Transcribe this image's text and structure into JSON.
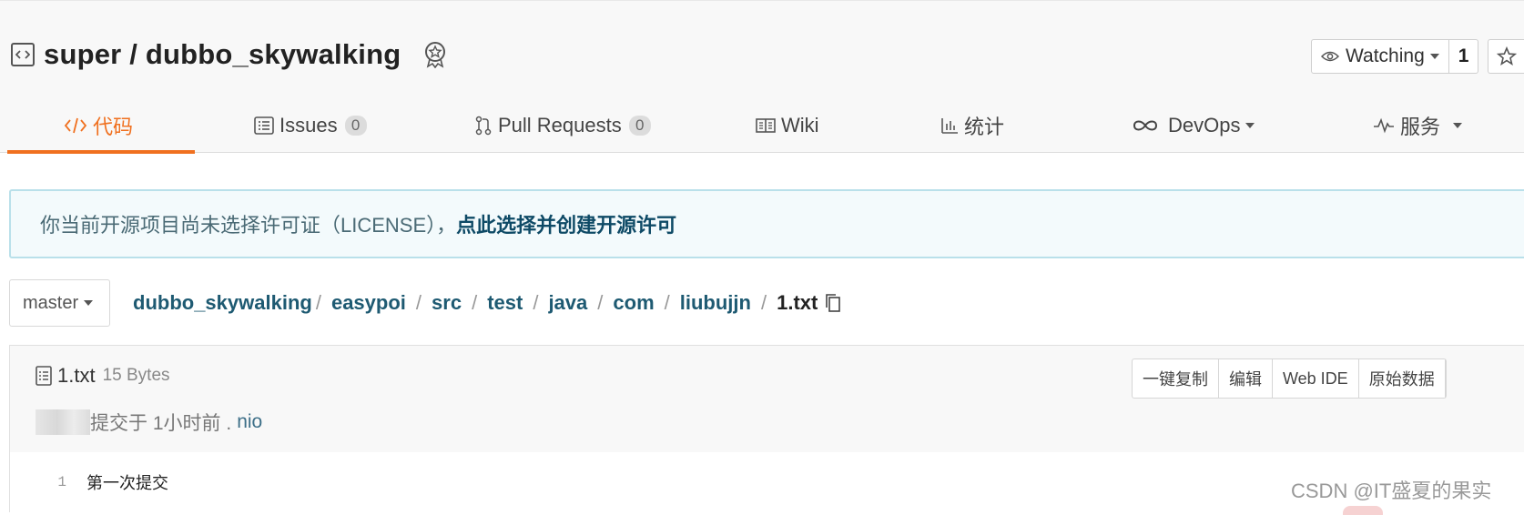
{
  "repo": {
    "title": "super / dubbo_skywalking"
  },
  "watch": {
    "label": "Watching",
    "count": "1"
  },
  "tabs": [
    {
      "label": "代码",
      "active": true
    },
    {
      "label": "Issues",
      "count": "0"
    },
    {
      "label": "Pull Requests",
      "count": "0"
    },
    {
      "label": "Wiki"
    },
    {
      "label": "统计"
    },
    {
      "label": "DevOps"
    },
    {
      "label": "服务"
    }
  ],
  "license": {
    "text": "你当前开源项目尚未选择许可证（LICENSE），",
    "link": "点此选择并创建开源许可"
  },
  "branch": {
    "name": "master"
  },
  "breadcrumb": {
    "root": "dubbo_skywalking",
    "parts": [
      "easypoi",
      "src",
      "test",
      "java",
      "com",
      "liubujjn"
    ],
    "file": "1.txt"
  },
  "file": {
    "name": "1.txt",
    "size": "15 Bytes",
    "commit_text": "提交于 1小时前 .",
    "author": "nio",
    "actions": [
      "一键复制",
      "编辑",
      "Web IDE",
      "原始数据"
    ],
    "lines": [
      {
        "num": "1",
        "text": "第一次提交"
      }
    ]
  },
  "watermark": "CSDN @IT盛夏的果实",
  "colors": {
    "accent": "#f0701f",
    "link": "#1e5a72",
    "banner_bg": "#f3fafc"
  }
}
